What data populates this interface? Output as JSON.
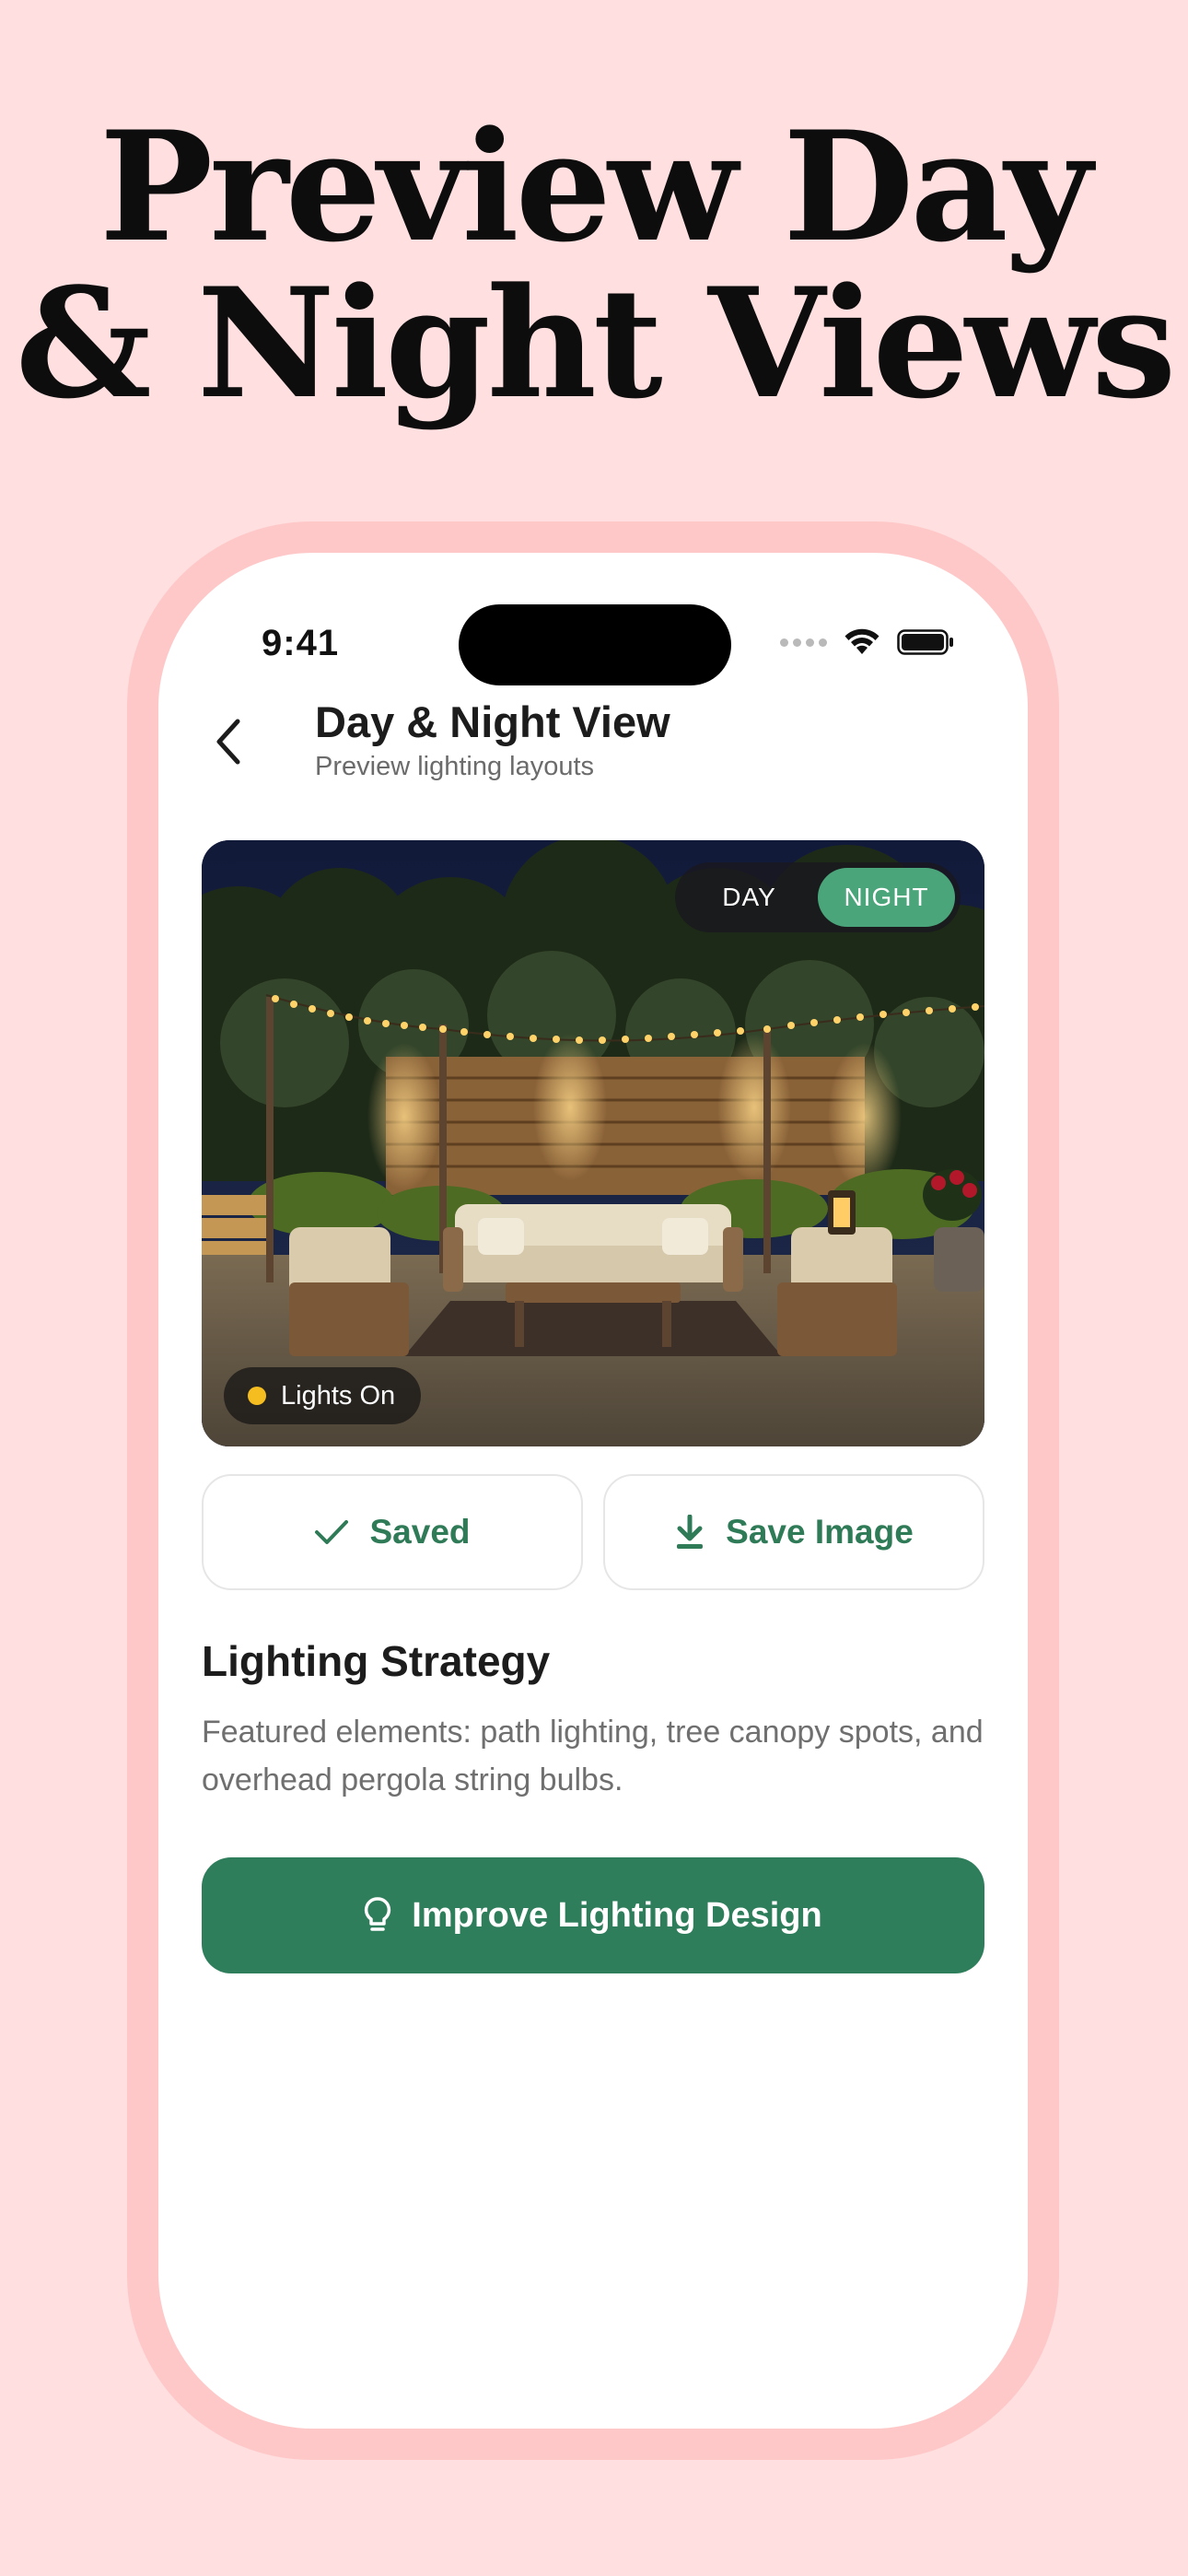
{
  "promo": {
    "headline_line1": "Preview Day",
    "headline_line2": "& Night Views"
  },
  "status_bar": {
    "time": "9:41"
  },
  "header": {
    "title": "Day & Night View",
    "subtitle": "Preview lighting layouts",
    "back_icon": "chevron-left-icon"
  },
  "hero": {
    "toggle": {
      "options": [
        "DAY",
        "NIGHT"
      ],
      "selected": "NIGHT"
    },
    "badge_label": "Lights On",
    "badge_color": "#f5bd1f"
  },
  "actions": {
    "saved_label": "Saved",
    "saved_icon": "checkmark-icon",
    "save_image_label": "Save Image",
    "save_image_icon": "download-icon"
  },
  "strategy": {
    "title": "Lighting Strategy",
    "description": "Featured elements: path lighting, tree canopy spots, and overhead pergola string bulbs."
  },
  "cta": {
    "label": "Improve Lighting Design",
    "icon": "lightbulb-icon"
  },
  "colors": {
    "background": "#ffdfdf",
    "frame": "#ffc8c8",
    "accent_green": "#2e7d5b",
    "toggle_active": "#4aa57a"
  }
}
